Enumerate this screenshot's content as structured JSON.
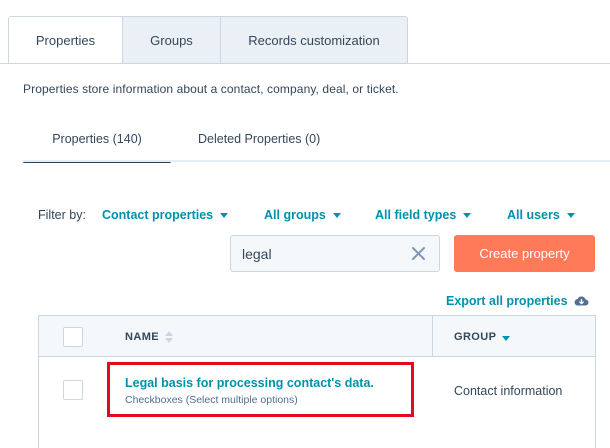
{
  "top_tabs": [
    {
      "label": "Properties",
      "active": true
    },
    {
      "label": "Groups",
      "active": false
    },
    {
      "label": "Records customization",
      "active": false
    }
  ],
  "description": "Properties store information about a contact, company, deal, or ticket.",
  "sub_tabs": [
    {
      "label": "Properties (140)",
      "active": true
    },
    {
      "label": "Deleted Properties (0)",
      "active": false
    }
  ],
  "filters": {
    "label": "Filter by:",
    "object": "Contact properties",
    "groups": "All groups",
    "field_types": "All field types",
    "users": "All users"
  },
  "search": {
    "value": "legal",
    "clear_icon": "close-icon"
  },
  "create_button": "Create property",
  "export_link": {
    "label": "Export all properties",
    "icon": "cloud-download-icon"
  },
  "table": {
    "columns": [
      {
        "label": "NAME",
        "sort": "none"
      },
      {
        "label": "GROUP",
        "sort": "descending"
      }
    ],
    "rows": [
      {
        "name": "Legal basis for processing contact's data.",
        "type": "Checkboxes (Select multiple options)",
        "group": "Contact information"
      }
    ]
  },
  "colors": {
    "accent_link": "#0091ae",
    "primary_button": "#ff7a59",
    "highlight_box": "#e00b1c",
    "text": "#33475b"
  }
}
